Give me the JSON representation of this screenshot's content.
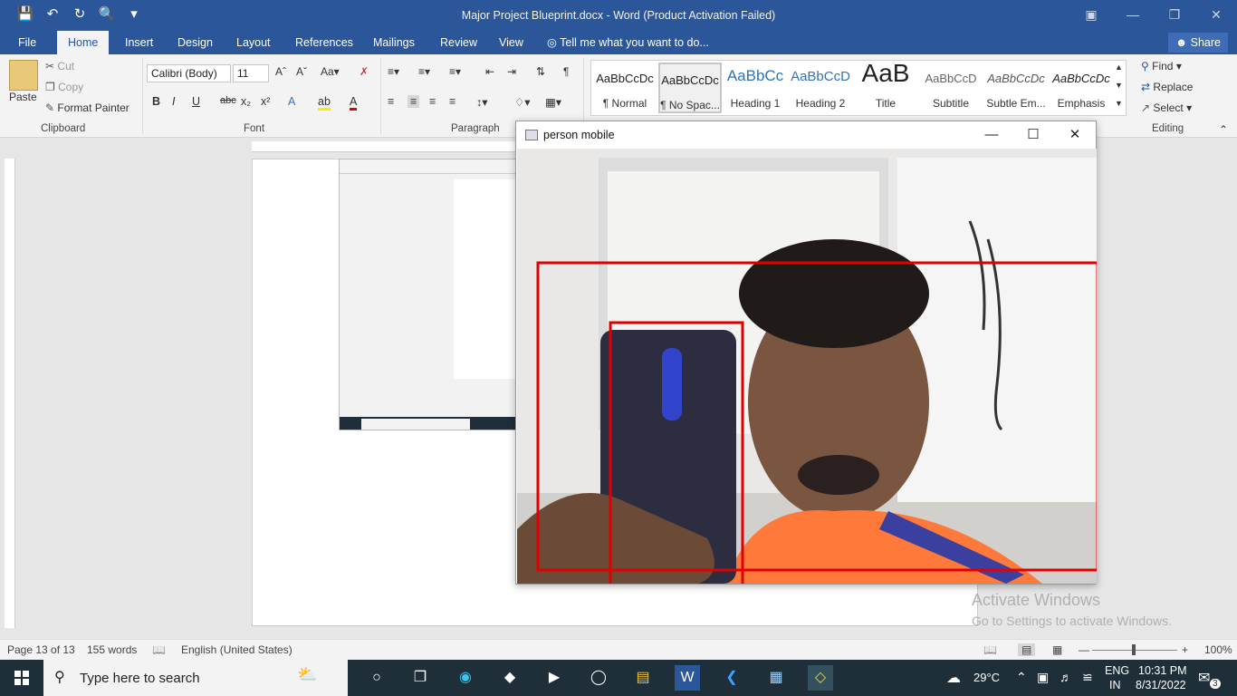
{
  "window": {
    "title": "Major Project Blueprint.docx  -  Word (Product Activation Failed)"
  },
  "tabs": [
    {
      "label": "File"
    },
    {
      "label": "Home"
    },
    {
      "label": "Insert"
    },
    {
      "label": "Design"
    },
    {
      "label": "Layout"
    },
    {
      "label": "References"
    },
    {
      "label": "Mailings"
    },
    {
      "label": "Review"
    },
    {
      "label": "View"
    }
  ],
  "tellme": "Tell me what you want to do...",
  "share": "Share",
  "clipboard": {
    "paste": "Paste",
    "cut": "Cut",
    "copy": "Copy",
    "format_painter": "Format Painter",
    "label": "Clipboard"
  },
  "font": {
    "name": "Calibri (Body)",
    "size": "11",
    "label": "Font"
  },
  "paragraph": {
    "label": "Paragraph"
  },
  "styles": [
    {
      "sample": "AaBbCcDc",
      "name": "¶ Normal"
    },
    {
      "sample": "AaBbCcDc",
      "name": "¶ No Spac..."
    },
    {
      "sample": "AaBbCc",
      "name": "Heading 1"
    },
    {
      "sample": "AaBbCcD",
      "name": "Heading 2"
    },
    {
      "sample": "AaB",
      "name": "Title"
    },
    {
      "sample": "AaBbCcD",
      "name": "Subtitle"
    },
    {
      "sample": "AaBbCcDc",
      "name": "Subtle Em..."
    },
    {
      "sample": "AaBbCcDc",
      "name": "Emphasis"
    }
  ],
  "editing": {
    "find": "Find",
    "replace": "Replace",
    "select": "Select",
    "label": "Editing"
  },
  "popup": {
    "title": "person mobile"
  },
  "watermark": {
    "line1": "Activate Windows",
    "line2": "Go to Settings to activate Windows."
  },
  "status": {
    "page": "Page 13 of 13",
    "words": "155 words",
    "language": "English (United States)",
    "zoom": "100%"
  },
  "taskbar": {
    "search_placeholder": "Type here to search",
    "weather": "29°C",
    "lang1": "ENG",
    "lang2": "IN",
    "time": "10:31 PM",
    "date": "8/31/2022",
    "notifications": "3"
  },
  "colors": {
    "word_blue": "#2b579a",
    "detection_box": "#e00000",
    "taskbar": "#1f2f3a"
  }
}
